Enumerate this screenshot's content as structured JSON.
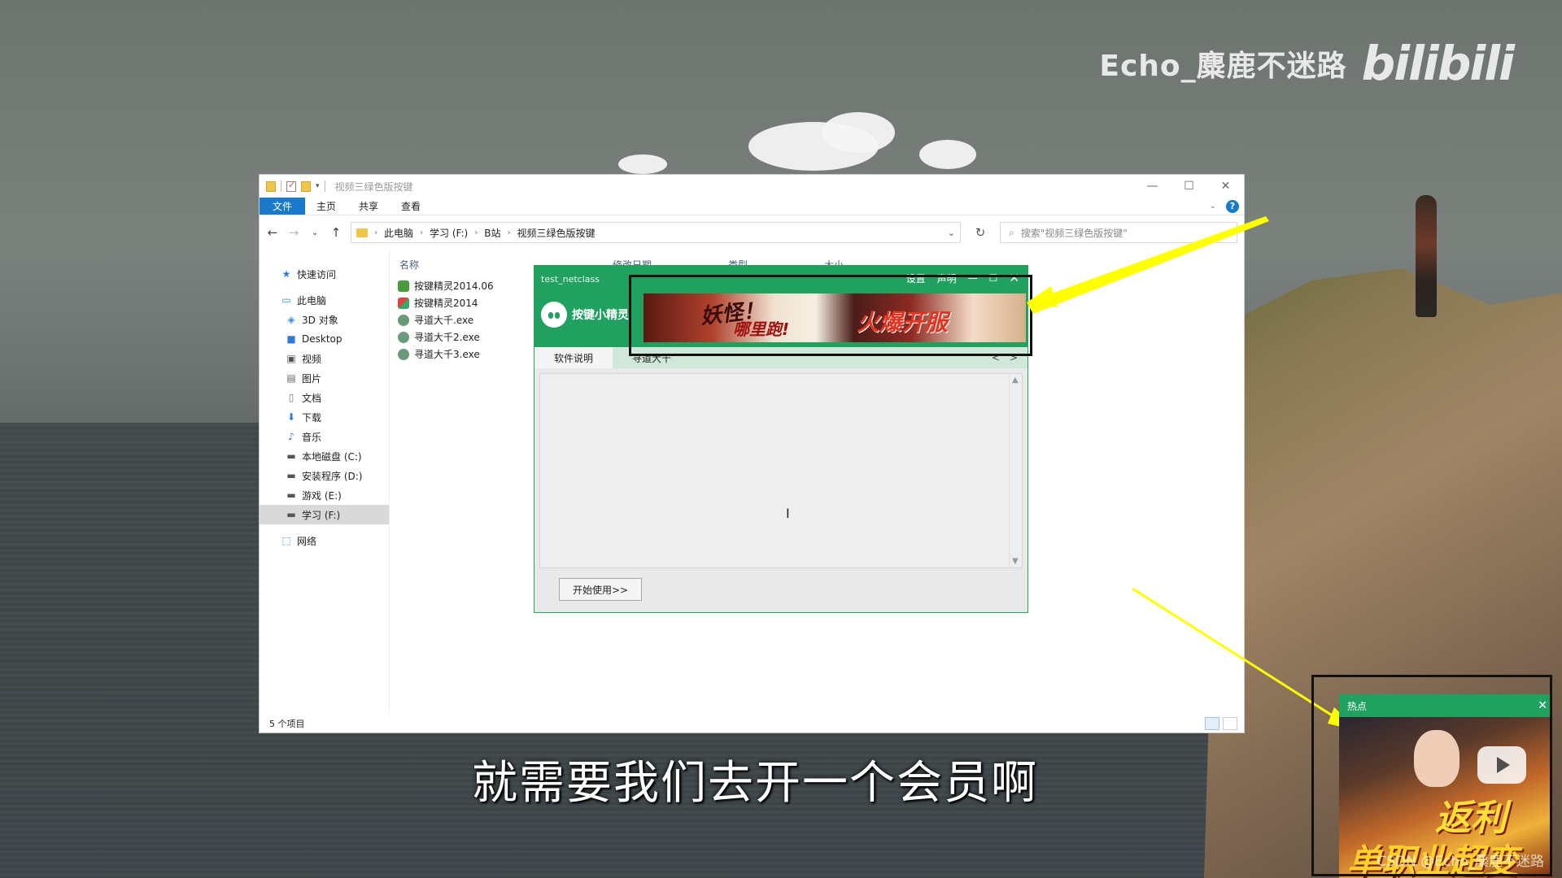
{
  "watermark": {
    "author": "Echo_麋鹿不迷路",
    "logo": "bilibili"
  },
  "subtitle": "就需要我们去开一个会员啊",
  "csdn_mark": "CSDN @Echo_麋鹿不迷路",
  "explorer": {
    "title": "视频三绿色版按键",
    "window_controls": {
      "minimize": "—",
      "maximize": "☐",
      "close": "✕"
    },
    "ribbon_tabs": [
      "文件",
      "主页",
      "共享",
      "查看"
    ],
    "help": "?",
    "breadcrumb": [
      "此电脑",
      "学习 (F:)",
      "B站",
      "视频三绿色版按键"
    ],
    "search_placeholder": "搜索\"视频三绿色版按键\"",
    "nav": {
      "quick_access": "快速访问",
      "this_pc": "此电脑",
      "items": [
        "3D 对象",
        "Desktop",
        "视频",
        "图片",
        "文档",
        "下载",
        "音乐",
        "本地磁盘 (C:)",
        "安装程序 (D:)",
        "游戏 (E:)",
        "学习 (F:)"
      ],
      "network": "网络"
    },
    "columns": [
      "名称",
      "修改日期",
      "类型",
      "大小"
    ],
    "files": [
      "按键精灵2014.06",
      "按键精灵2014",
      "寻道大千.exe",
      "寻道大千2.exe",
      "寻道大千3.exe"
    ],
    "status": "5 个项目"
  },
  "app": {
    "title": "test_netclass",
    "controls": {
      "settings": "设置",
      "statement": "声明",
      "minimize": "—",
      "maximize": "☐",
      "close": "✕"
    },
    "brand": "按键小精灵",
    "banner": {
      "text1": "妖怪！",
      "text2": "哪里跑!",
      "text3": "火爆开服"
    },
    "tabs": [
      "软件说明",
      "寻道大千"
    ],
    "tab_arrows": {
      "prev": "<",
      "next": ">"
    },
    "start_button": "开始使用>>"
  },
  "hot_popup": {
    "title": "热点",
    "close": "✕",
    "text1": "返利",
    "text2": "单职业超变"
  },
  "colors": {
    "app_green": "#20a160",
    "explorer_blue": "#1979ca",
    "arrow_yellow": "#ffff00"
  }
}
